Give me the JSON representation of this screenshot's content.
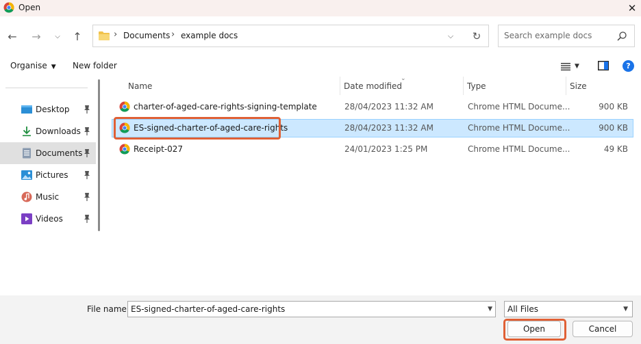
{
  "window": {
    "title": "Open"
  },
  "nav": {
    "breadcrumb": [
      "Documents",
      "example docs"
    ],
    "search_placeholder": "Search example docs"
  },
  "toolbar": {
    "organise_label": "Organise",
    "new_folder_label": "New folder"
  },
  "sidebar": {
    "items": [
      {
        "label": "Desktop",
        "icon": "desktop-icon"
      },
      {
        "label": "Downloads",
        "icon": "download-icon"
      },
      {
        "label": "Documents",
        "icon": "documents-icon",
        "selected": true
      },
      {
        "label": "Pictures",
        "icon": "pictures-icon"
      },
      {
        "label": "Music",
        "icon": "music-icon"
      },
      {
        "label": "Videos",
        "icon": "videos-icon"
      }
    ]
  },
  "columns": {
    "name": "Name",
    "date": "Date modified",
    "type": "Type",
    "size": "Size"
  },
  "files": [
    {
      "name": "charter-of-aged-care-rights-signing-template",
      "date": "28/04/2023 11:32 AM",
      "type": "Chrome HTML Docume...",
      "size": "900 KB",
      "selected": false
    },
    {
      "name": "ES-signed-charter-of-aged-care-rights",
      "date": "28/04/2023 11:32 AM",
      "type": "Chrome HTML Docume...",
      "size": "900 KB",
      "selected": true
    },
    {
      "name": "Receipt-027",
      "date": "24/01/2023 1:25 PM",
      "type": "Chrome HTML Docume...",
      "size": "49 KB",
      "selected": false
    }
  ],
  "footer": {
    "file_name_label": "File name:",
    "file_name_value": "ES-signed-charter-of-aged-care-rights",
    "file_type": "All Files",
    "open_label": "Open",
    "cancel_label": "Cancel"
  },
  "colors": {
    "selection": "#cce8ff",
    "highlight": "#e06035",
    "help": "#1a73e8"
  }
}
